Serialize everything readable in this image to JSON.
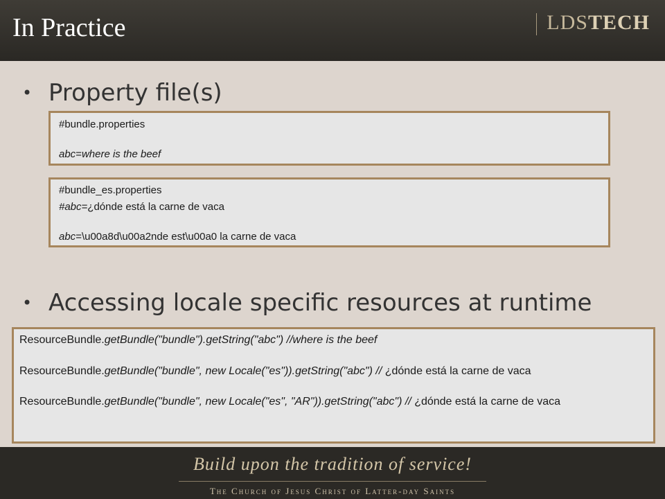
{
  "header": {
    "title": "In Practice",
    "logo_lds": "LDS",
    "logo_tech": "TECH"
  },
  "bullets": [
    {
      "marker": "•",
      "text": "Property file(s)"
    },
    {
      "marker": "•",
      "text": "Accessing locale specific resources at runtime"
    }
  ],
  "box1": {
    "line1": "#bundle.properties",
    "line2_key": "abc",
    "line2_eq": "=",
    "line2_value": "where is the beef"
  },
  "box2": {
    "line1": "#bundle_es.properties",
    "line2_prefix": "#abc=",
    "line2_value": "¿dónde está la carne de vaca",
    "line3_key": "abc",
    "line3_value": "=\\u00a8d\\u00a2nde est\\u00a0 la carne de vaca"
  },
  "box3": {
    "line1_a": "ResourceBundle.",
    "line1_b": "getBundle(\"bundle\").getString(\"abc\")     //where is the beef",
    "line2_a": "ResourceBundle.",
    "line2_b": "getBundle(\"bundle\", new Locale(\"es\")).getString(\"abc\")  // ",
    "line2_c": "¿dónde está la carne de vaca",
    "line3_a": "ResourceBundle.",
    "line3_b": "getBundle(\"bundle\", new Locale(\"es\", \"AR\")).getString(\"abc\")  // ",
    "line3_c": "¿dónde está la carne de vaca"
  },
  "footer": {
    "tagline": "Build upon the tradition of service!",
    "church": "The Church of Jesus Christ of Latter-day Saints"
  },
  "colors": {
    "header_bg": "#2f2d28",
    "slide_bg": "#ddd5ce",
    "box_border": "#a6865d",
    "box_bg": "#e6e6e6",
    "logo": "#c7b99c"
  }
}
